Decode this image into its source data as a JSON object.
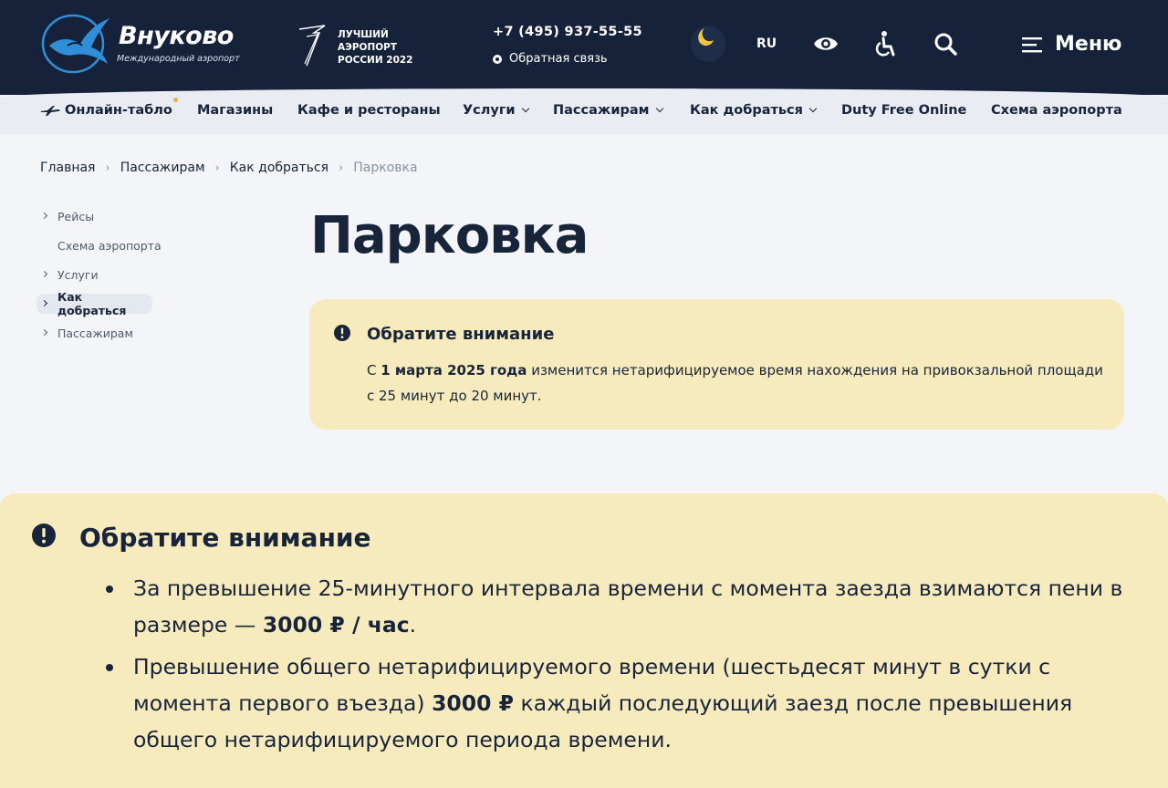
{
  "header": {
    "logo_title": "Внуково",
    "logo_subtitle": "Международный аэропорт",
    "award_text": "ЛУЧШИЙ\nАЭРОПОРТ\nРОССИИ 2022",
    "phone": "+7 (495) 937-55-55",
    "feedback": "Обратная связь",
    "lang": "RU",
    "menu_label": "Меню",
    "icons": [
      "moon-icon",
      "eye-icon",
      "accessibility-icon",
      "search-icon",
      "hamburger-icon"
    ]
  },
  "nav": {
    "items": [
      {
        "label": "Онлайн-табло"
      },
      {
        "label": "Магазины"
      },
      {
        "label": "Кафе и рестораны"
      },
      {
        "label": "Услуги"
      },
      {
        "label": "Пассажирам"
      },
      {
        "label": "Как добраться"
      },
      {
        "label": "Duty Free Online"
      },
      {
        "label": "Схема аэропорта"
      }
    ]
  },
  "breadcrumb": {
    "items": [
      "Главная",
      "Пассажирам",
      "Как добраться"
    ],
    "current": "Парковка"
  },
  "sidebar": {
    "items": [
      {
        "label": "Рейсы"
      },
      {
        "label": "Схема аэропорта"
      },
      {
        "label": "Услуги"
      },
      {
        "label": "Как добраться"
      },
      {
        "label": "Пассажирам"
      }
    ]
  },
  "page": {
    "title": "Парковка"
  },
  "notice1": {
    "title": "Обратите внимание",
    "text_pre": "С ",
    "text_bold": "1 марта 2025 года",
    "text_post": " изменится нетарифицируемое время нахождения на привокзальной площади с 25 минут до 20 минут."
  },
  "notice2": {
    "title": "Обратите внимание",
    "item1_pre": "За превышение 25-минутного интервала времени с момента заезда взимаются пени в размере — ",
    "item1_bold": "3000 ₽ / час",
    "item1_post": ".",
    "item2_pre": "Превышение общего нетарифицируемого времени (шестьдесят минут в сутки с момента первого въезда) ",
    "item2_bold": "3000 ₽",
    "item2_post": " каждый последующий заезд после превышения общего нетарифицируемого периода времени."
  },
  "colors": {
    "header_bg": "#16223a",
    "nav_bg": "#e9ecf2",
    "notice_bg": "#f7ebbd",
    "accent_blue": "#2f8fd8",
    "moon": "#f0c544"
  }
}
